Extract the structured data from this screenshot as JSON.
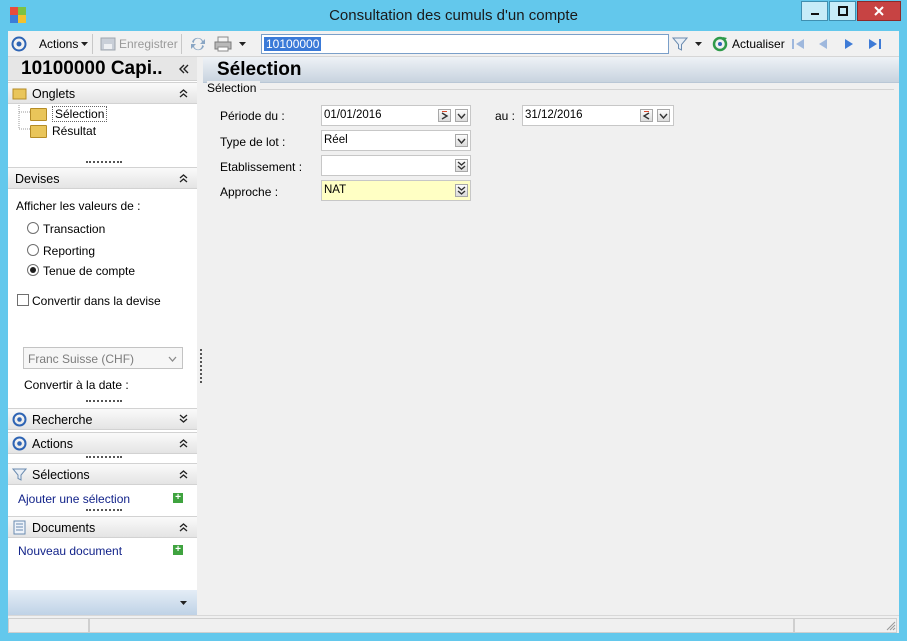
{
  "window": {
    "title": "Consultation des cumuls d'un compte",
    "colors": {
      "frame": "#63c8ec",
      "close": "#c74343"
    }
  },
  "toolbar": {
    "actions_label": "Actions",
    "save_label": "Enregistrer",
    "account_id": "10100000",
    "refresh_label": "Actualiser"
  },
  "sidebar": {
    "title": "10100000 Capi..",
    "onglets": {
      "label": "Onglets",
      "items": [
        "Sélection",
        "Résultat"
      ]
    },
    "devises": {
      "label": "Devises",
      "show_values_label": "Afficher les valeurs de :",
      "options": [
        "Transaction",
        "Reporting",
        "Tenue de compte"
      ],
      "selected_index": 2,
      "convert_label": "Convertir dans la devise",
      "currency_value": "Franc Suisse (CHF)",
      "convert_date_label": "Convertir à la date :"
    },
    "recherche_label": "Recherche",
    "actions_label": "Actions",
    "selections": {
      "label": "Sélections",
      "add_link": "Ajouter une sélection"
    },
    "documents": {
      "label": "Documents",
      "new_link": "Nouveau document"
    }
  },
  "main": {
    "title": "Sélection",
    "group_label": "Sélection",
    "fields": {
      "periode_label": "Période du :",
      "periode_from": "01/01/2016",
      "au_label": "au :",
      "periode_to": "31/12/2016",
      "type_lot_label": "Type de lot :",
      "type_lot_value": "Réel",
      "etablissement_label": "Etablissement :",
      "etablissement_value": "",
      "approche_label": "Approche :",
      "approche_value": "NAT"
    }
  }
}
